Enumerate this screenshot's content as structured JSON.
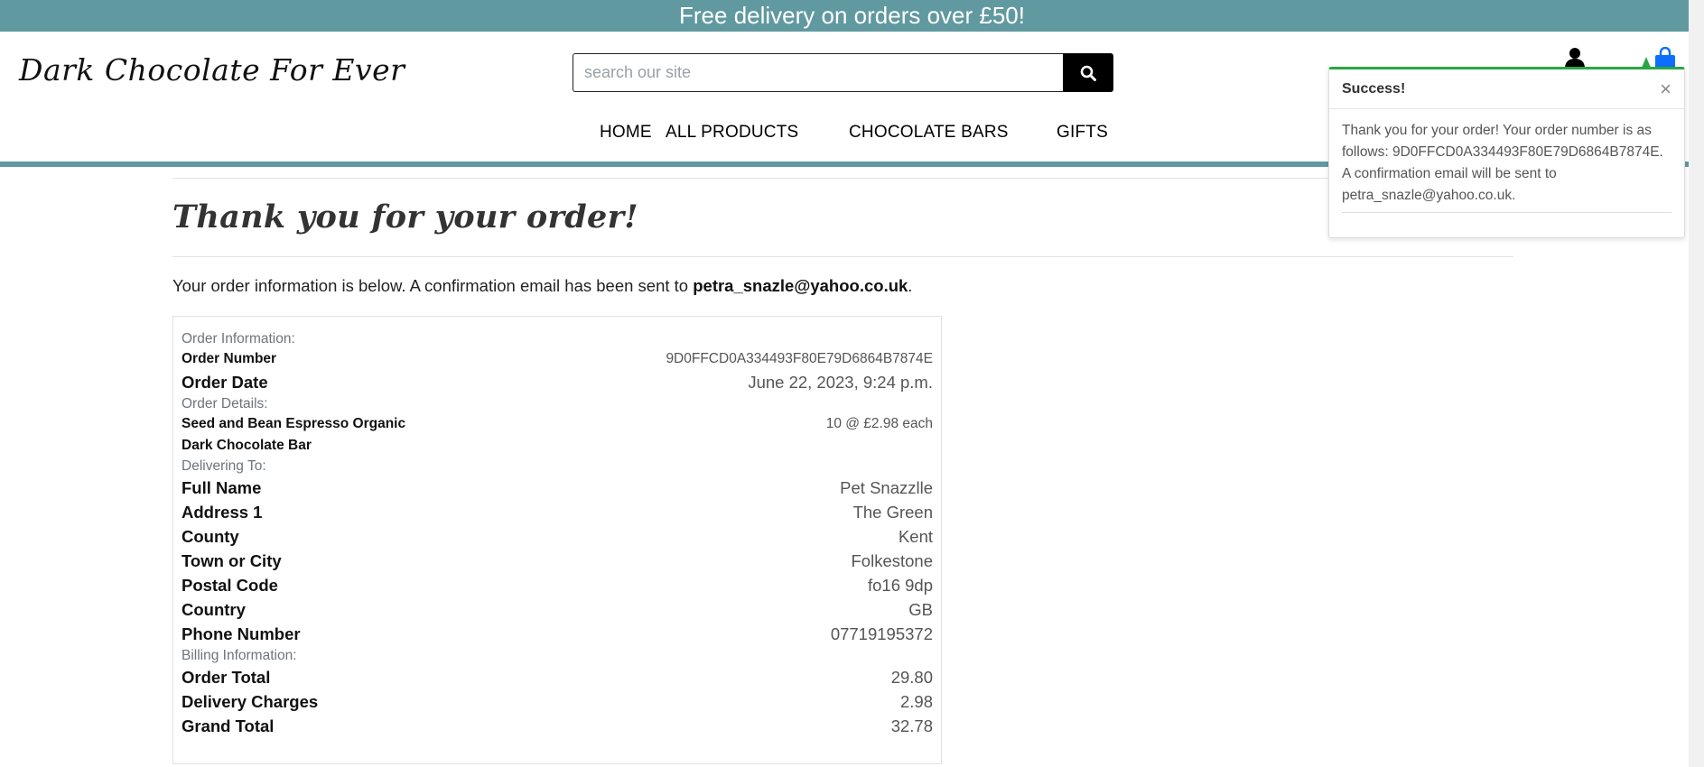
{
  "banner": {
    "text": "Free delivery on orders over £50!"
  },
  "header": {
    "brand": "Dark Chocolate For Ever",
    "search_placeholder": "search our site",
    "user_icon": "user-icon",
    "bag_icon": "shopping-bag-icon"
  },
  "nav": {
    "items": [
      {
        "label": "HOME"
      },
      {
        "label": "ALL PRODUCTS"
      },
      {
        "label": "CHOCOLATE BARS"
      },
      {
        "label": "GIFTS"
      }
    ]
  },
  "page": {
    "title": "Thank you for your order!",
    "intro_prefix": "Your order information is below. A confirmation email has been sent to ",
    "intro_email": "petra_snazle@yahoo.co.uk",
    "intro_suffix": "."
  },
  "order": {
    "info_heading": "Order Information:",
    "number_label": "Order Number",
    "number_value": "9D0FFCD0A334493F80E79D6864B7874E",
    "date_label": "Order Date",
    "date_value": "June 22, 2023, 9:24 p.m.",
    "details_heading": "Order Details:",
    "product_name": "Seed and Bean Espresso Organic Dark Chocolate Bar",
    "product_qty": "10 @ £2.98 each",
    "delivery_heading": "Delivering To:",
    "delivery": [
      {
        "label": "Full Name",
        "value": "Pet Snazzlle"
      },
      {
        "label": "Address 1",
        "value": "The Green"
      },
      {
        "label": "County",
        "value": "Kent"
      },
      {
        "label": "Town or City",
        "value": "Folkestone"
      },
      {
        "label": "Postal Code",
        "value": "fo16 9dp"
      },
      {
        "label": "Country",
        "value": "GB"
      },
      {
        "label": "Phone Number",
        "value": "07719195372"
      }
    ],
    "billing_heading": "Billing Information:",
    "billing": [
      {
        "label": "Order Total",
        "value": "29.80"
      },
      {
        "label": "Delivery Charges",
        "value": "2.98"
      },
      {
        "label": "Grand Total",
        "value": "32.78"
      }
    ]
  },
  "toast": {
    "title": "Success!",
    "close": "×",
    "message": "Thank you for your order! Your order number is as follows: 9D0FFCD0A334493F80E79D6864B7874E. A confirmation email will be sent to petra_snazle@yahoo.co.uk."
  },
  "colors": {
    "brand_teal": "#6199a0",
    "success_green": "#28a745",
    "bag_blue": "#0d6efd"
  }
}
